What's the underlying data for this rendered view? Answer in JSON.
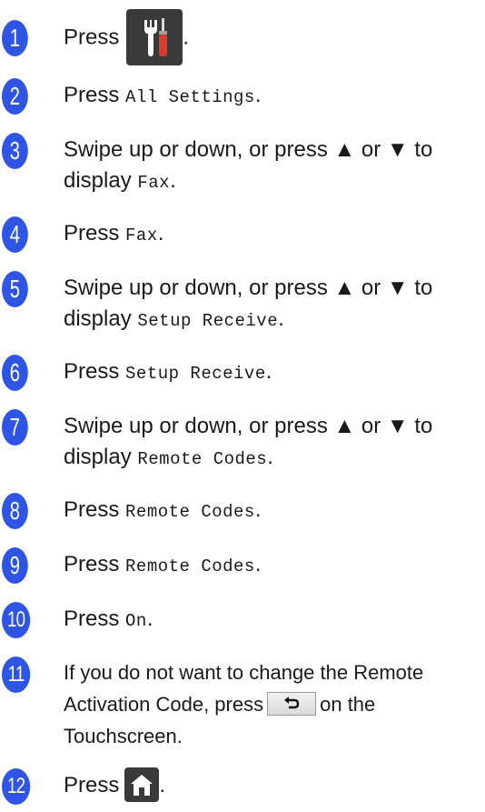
{
  "steps": [
    {
      "number": "1",
      "parts": {
        "a": "Press",
        "end": "."
      }
    },
    {
      "number": "2",
      "parts": {
        "a": "Press ",
        "code": "All Settings",
        "end": "."
      }
    },
    {
      "number": "3",
      "parts": {
        "line1": "Swipe up or down, or press ▲ or ▼ to",
        "a": "display ",
        "code": "Fax",
        "end": "."
      }
    },
    {
      "number": "4",
      "parts": {
        "a": "Press ",
        "code": "Fax",
        "end": "."
      }
    },
    {
      "number": "5",
      "parts": {
        "line1": "Swipe up or down, or press ▲ or ▼ to",
        "a": "display ",
        "code": "Setup Receive",
        "end": "."
      }
    },
    {
      "number": "6",
      "parts": {
        "a": "Press ",
        "code": "Setup Receive",
        "end": "."
      }
    },
    {
      "number": "7",
      "parts": {
        "line1": "Swipe up or down, or press ▲ or ▼ to",
        "a": "display ",
        "code": "Remote Codes",
        "end": "."
      }
    },
    {
      "number": "8",
      "parts": {
        "a": "Press ",
        "code": "Remote Codes",
        "end": "."
      }
    },
    {
      "number": "9",
      "parts": {
        "a": "Press ",
        "code": "Remote Codes",
        "end": "."
      }
    },
    {
      "number": "10",
      "parts": {
        "a": "Press ",
        "code": "On",
        "end": "."
      }
    },
    {
      "number": "11",
      "parts": {
        "line1": "If you do not want to change the Remote",
        "a": "Activation Code, press",
        "b": "on the",
        "line3": "Touchscreen."
      }
    },
    {
      "number": "12",
      "parts": {
        "a": "Press",
        "end": "."
      }
    }
  ],
  "icons": {
    "settings": "tools-settings-icon",
    "back": "back-arrow-icon",
    "home": "home-icon"
  },
  "colors": {
    "step_badge": "#2f55e6",
    "icon_button": "#3a3a3a",
    "wrench": "#ffffff",
    "screwdriver_handle": "#e03a2f"
  }
}
